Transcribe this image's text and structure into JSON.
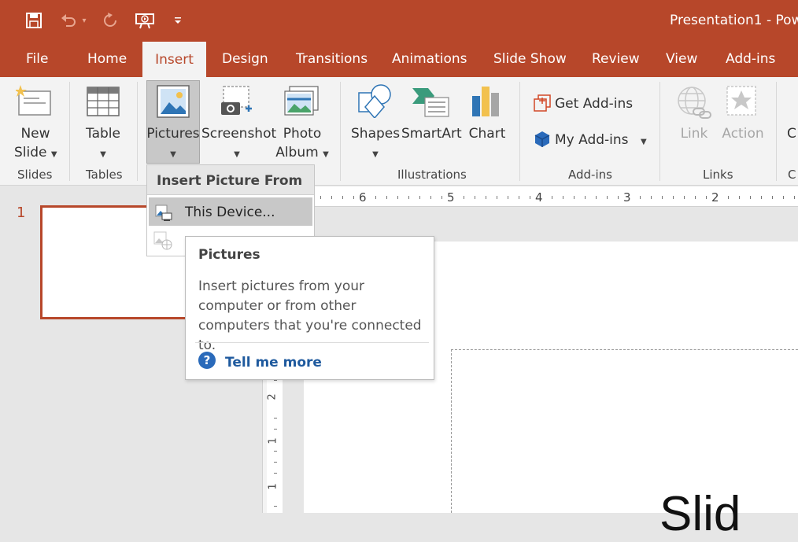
{
  "window": {
    "title": "Presentation1  -  Pow"
  },
  "tabs": [
    "File",
    "Home",
    "Insert",
    "Design",
    "Transitions",
    "Animations",
    "Slide Show",
    "Review",
    "View",
    "Add-ins"
  ],
  "ribbon": {
    "new_slide": [
      "New",
      "Slide"
    ],
    "table": "Table",
    "pictures": "Pictures",
    "screenshot": "Screenshot",
    "photo_album": [
      "Photo",
      "Album"
    ],
    "shapes": "Shapes",
    "smartart": "SmartArt",
    "chart": "Chart",
    "get_addins": "Get Add-ins",
    "my_addins": "My Add-ins",
    "link": "Link",
    "action": "Action",
    "cut_label": "C",
    "groups": {
      "slides": "Slides",
      "tables": "Tables",
      "illustrations": "Illustrations",
      "addins": "Add-ins",
      "links": "Links",
      "cut": "C"
    }
  },
  "ruler": {
    "h_labels": [
      "6",
      "5",
      "4",
      "3",
      "2"
    ],
    "v_labels": [
      "2",
      "1",
      "1"
    ]
  },
  "slides_pane": {
    "slide_number": "1"
  },
  "menu": {
    "header": "Insert Picture From",
    "item_this_device": "This Device..."
  },
  "tooltip": {
    "title": "Pictures",
    "body": "Insert pictures from your computer or from other computers that you're connected to.",
    "tell_more": "Tell me more"
  },
  "slide": {
    "partial_text": "Slid"
  },
  "colors": {
    "accent": "#b7472a",
    "link": "#1f5a9e"
  }
}
